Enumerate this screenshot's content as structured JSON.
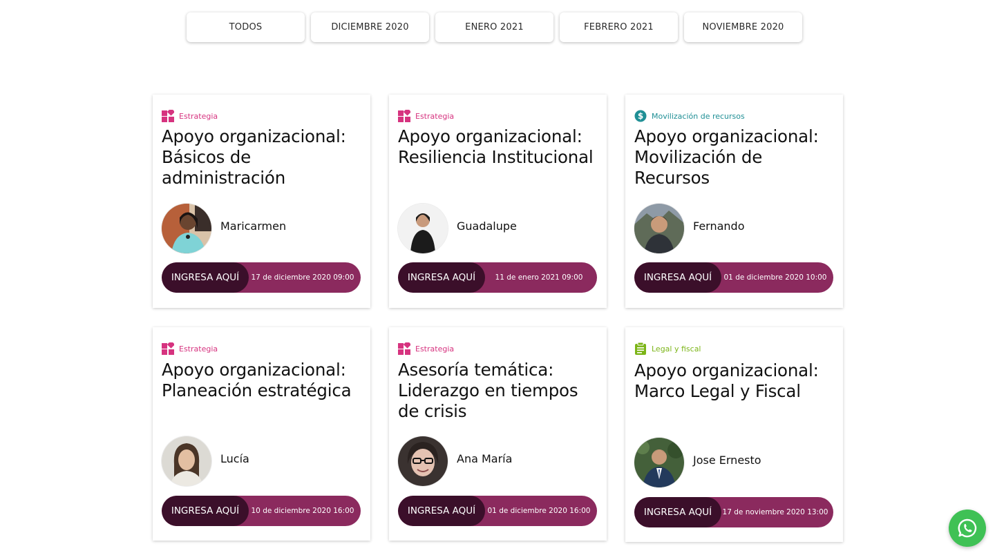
{
  "filters": [
    "TODOS",
    "DICIEMBRE 2020",
    "ENERO 2021",
    "FEBRERO 2021",
    "NOVIEMBRE 2020"
  ],
  "colors": {
    "estrategia": "#d6337f",
    "movilizacion": "#1f8f95",
    "legal": "#7cb518",
    "cta_dark": "#3b0f2a",
    "cta_light": "#8b2a5e",
    "whatsapp": "#3fc155"
  },
  "cards": [
    {
      "category": "Estrategia",
      "category_icon": "tiles-icon",
      "title": "Apoyo organizacional: Básicos de administración",
      "person": "Maricarmen",
      "cta_label": "INGRESA AQUÍ",
      "date": "17 de diciembre 2020 09:00"
    },
    {
      "category": "Estrategia",
      "category_icon": "tiles-icon",
      "title": "Apoyo organizacional: Resiliencia Institucional",
      "person": "Guadalupe",
      "cta_label": "INGRESA AQUÍ",
      "date": "11 de enero 2021 09:00"
    },
    {
      "category": "Movilización de recursos",
      "category_icon": "dollar-coin-icon",
      "title": "Apoyo organizacional: Movilización de Recursos",
      "person": "Fernando",
      "cta_label": "INGRESA AQUÍ",
      "date": "01 de diciembre 2020 10:00"
    },
    {
      "category": "Estrategia",
      "category_icon": "tiles-icon",
      "title": "Apoyo organizacional: Planeación estratégica",
      "person": "Lucía",
      "cta_label": "INGRESA AQUÍ",
      "date": "10 de diciembre 2020 16:00"
    },
    {
      "category": "Estrategia",
      "category_icon": "tiles-icon",
      "title": "Asesoría temática: Liderazgo en tiempos de crisis",
      "person": "Ana María",
      "cta_label": "INGRESA AQUÍ",
      "date": "01 de diciembre 2020 16:00"
    },
    {
      "category": "Legal y fiscal",
      "category_icon": "clipboard-icon",
      "title": "Apoyo organizacional: Marco Legal y Fiscal",
      "person": "Jose Ernesto",
      "cta_label": "INGRESA AQUÍ",
      "date": "17 de noviembre 2020 13:00"
    }
  ],
  "whatsapp_icon": "whatsapp-icon"
}
